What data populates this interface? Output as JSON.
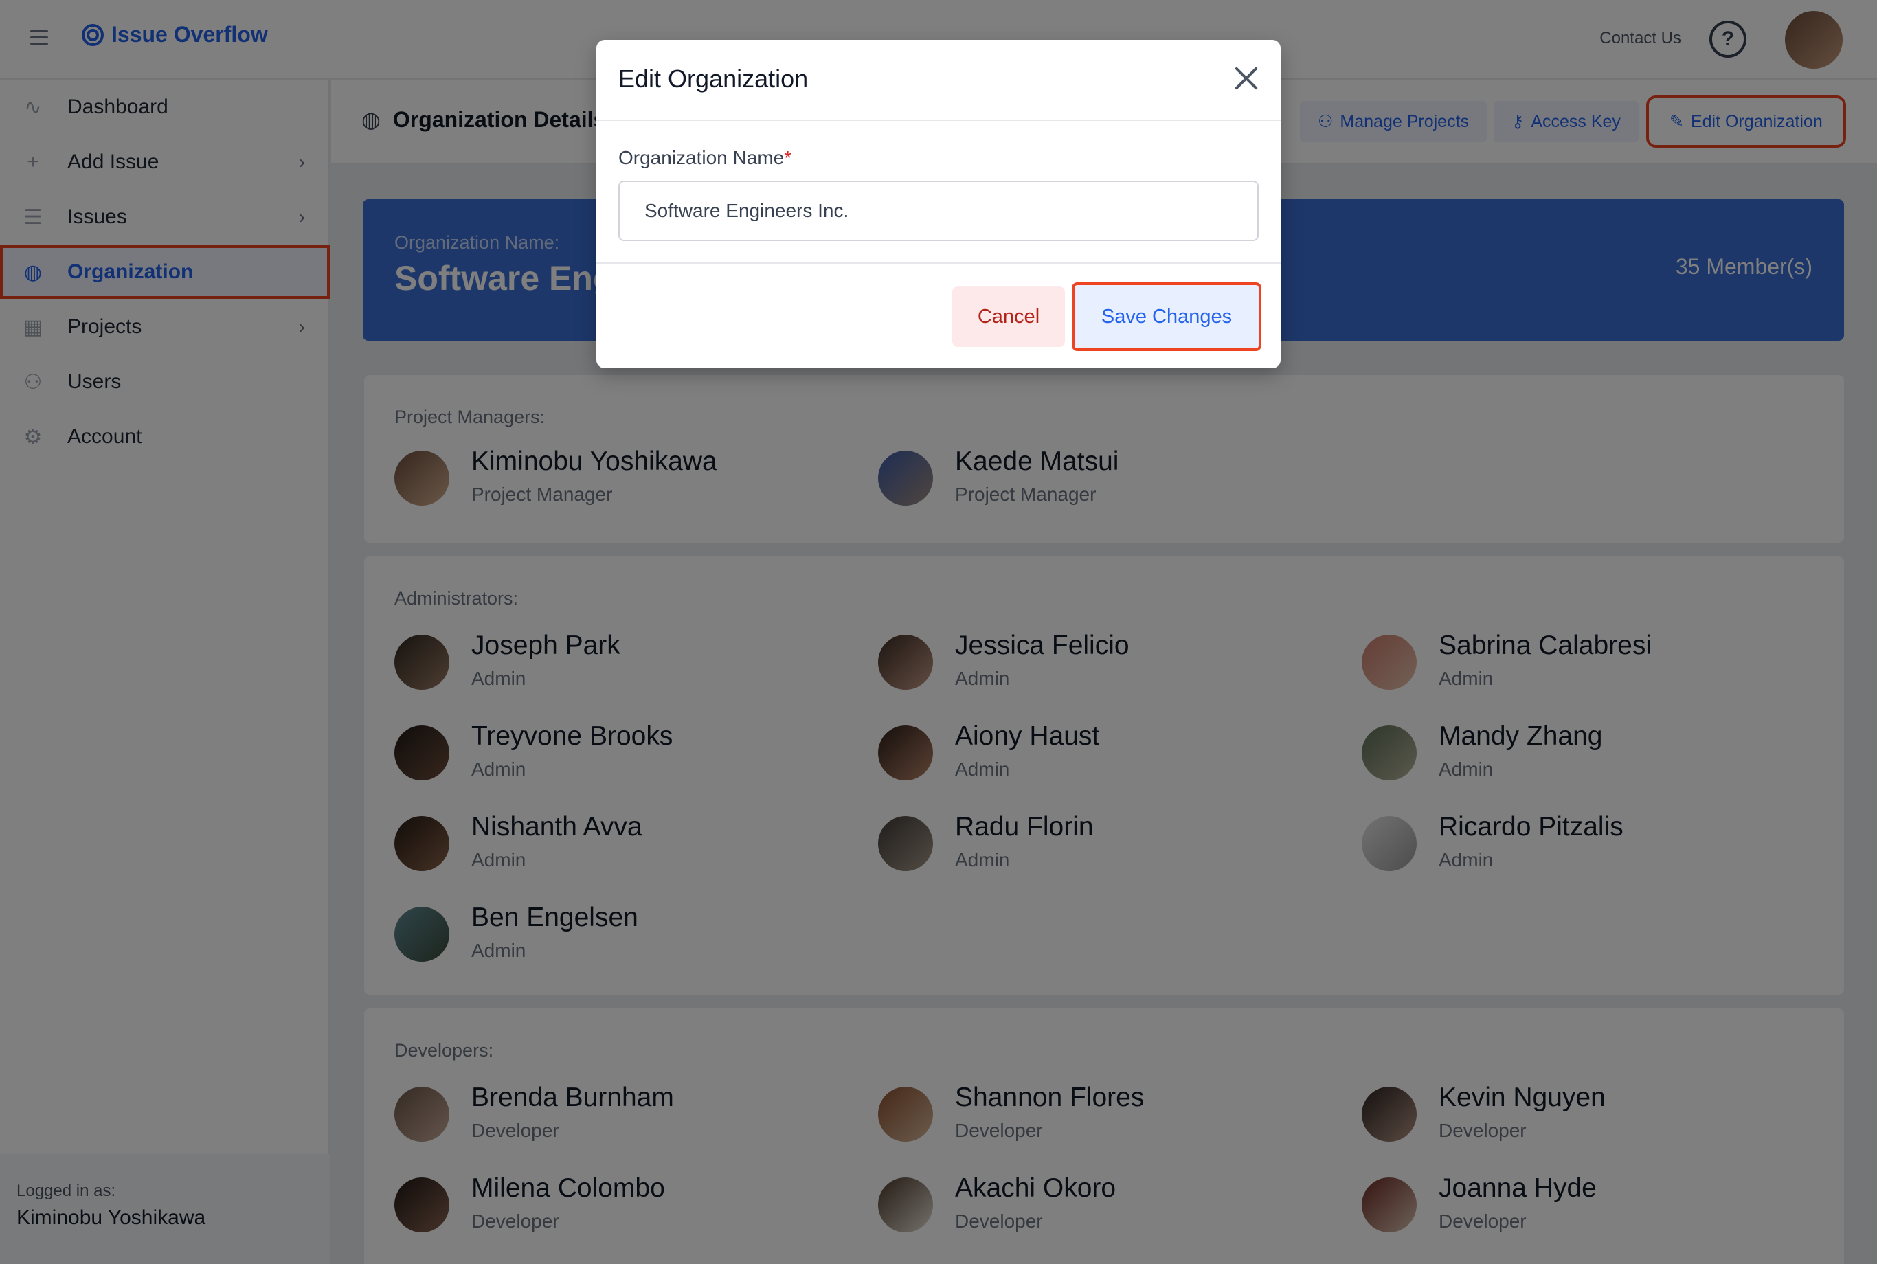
{
  "app": {
    "logo_text": "Issue Overflow",
    "contact_label": "Contact Us",
    "help_glyph": "?"
  },
  "sidebar": {
    "items": [
      {
        "label": "Dashboard",
        "icon": "activity-icon"
      },
      {
        "label": "Add Issue",
        "icon": "plus-icon"
      },
      {
        "label": "Issues",
        "icon": "list-icon"
      },
      {
        "label": "Organization",
        "icon": "globe-icon"
      },
      {
        "label": "Projects",
        "icon": "grid-icon"
      },
      {
        "label": "Users",
        "icon": "users-icon"
      },
      {
        "label": "Account",
        "icon": "gear-icon"
      }
    ],
    "logged_label": "Logged in as:",
    "logged_user": "Kiminobu Yoshikawa"
  },
  "header": {
    "title": "Organization Details",
    "buttons": {
      "manage_projects": "Manage Projects",
      "access_key": "Access Key",
      "edit_org": "Edit Organization"
    }
  },
  "banner": {
    "label": "Organization Name:",
    "name": "Software Engineers Inc.",
    "members": "35 Member(s)"
  },
  "sections": {
    "pm_label": "Project Managers:",
    "admin_label": "Administrators:",
    "dev_label": "Developers:"
  },
  "project_managers": [
    {
      "name": "Kiminobu Yoshikawa",
      "role": "Project Manager"
    },
    {
      "name": "Kaede Matsui",
      "role": "Project Manager"
    }
  ],
  "administrators": [
    {
      "name": "Joseph Park",
      "role": "Admin"
    },
    {
      "name": "Jessica Felicio",
      "role": "Admin"
    },
    {
      "name": "Sabrina Calabresi",
      "role": "Admin"
    },
    {
      "name": "Treyvone Brooks",
      "role": "Admin"
    },
    {
      "name": "Aiony Haust",
      "role": "Admin"
    },
    {
      "name": "Mandy Zhang",
      "role": "Admin"
    },
    {
      "name": "Nishanth Avva",
      "role": "Admin"
    },
    {
      "name": "Radu Florin",
      "role": "Admin"
    },
    {
      "name": "Ricardo Pitzalis",
      "role": "Admin"
    },
    {
      "name": "Ben Engelsen",
      "role": "Admin"
    }
  ],
  "developers": [
    {
      "name": "Brenda Burnham",
      "role": "Developer"
    },
    {
      "name": "Shannon Flores",
      "role": "Developer"
    },
    {
      "name": "Kevin Nguyen",
      "role": "Developer"
    },
    {
      "name": "Milena Colombo",
      "role": "Developer"
    },
    {
      "name": "Akachi Okoro",
      "role": "Developer"
    },
    {
      "name": "Joanna Hyde",
      "role": "Developer"
    }
  ],
  "modal": {
    "title": "Edit Organization",
    "field_label": "Organization Name",
    "required_mark": "*",
    "field_value": "Software Engineers Inc.",
    "cancel": "Cancel",
    "save": "Save Changes"
  },
  "colors": {
    "accent": "#2563eb",
    "highlight": "#ef4422",
    "banner": "#3b6fd4"
  }
}
